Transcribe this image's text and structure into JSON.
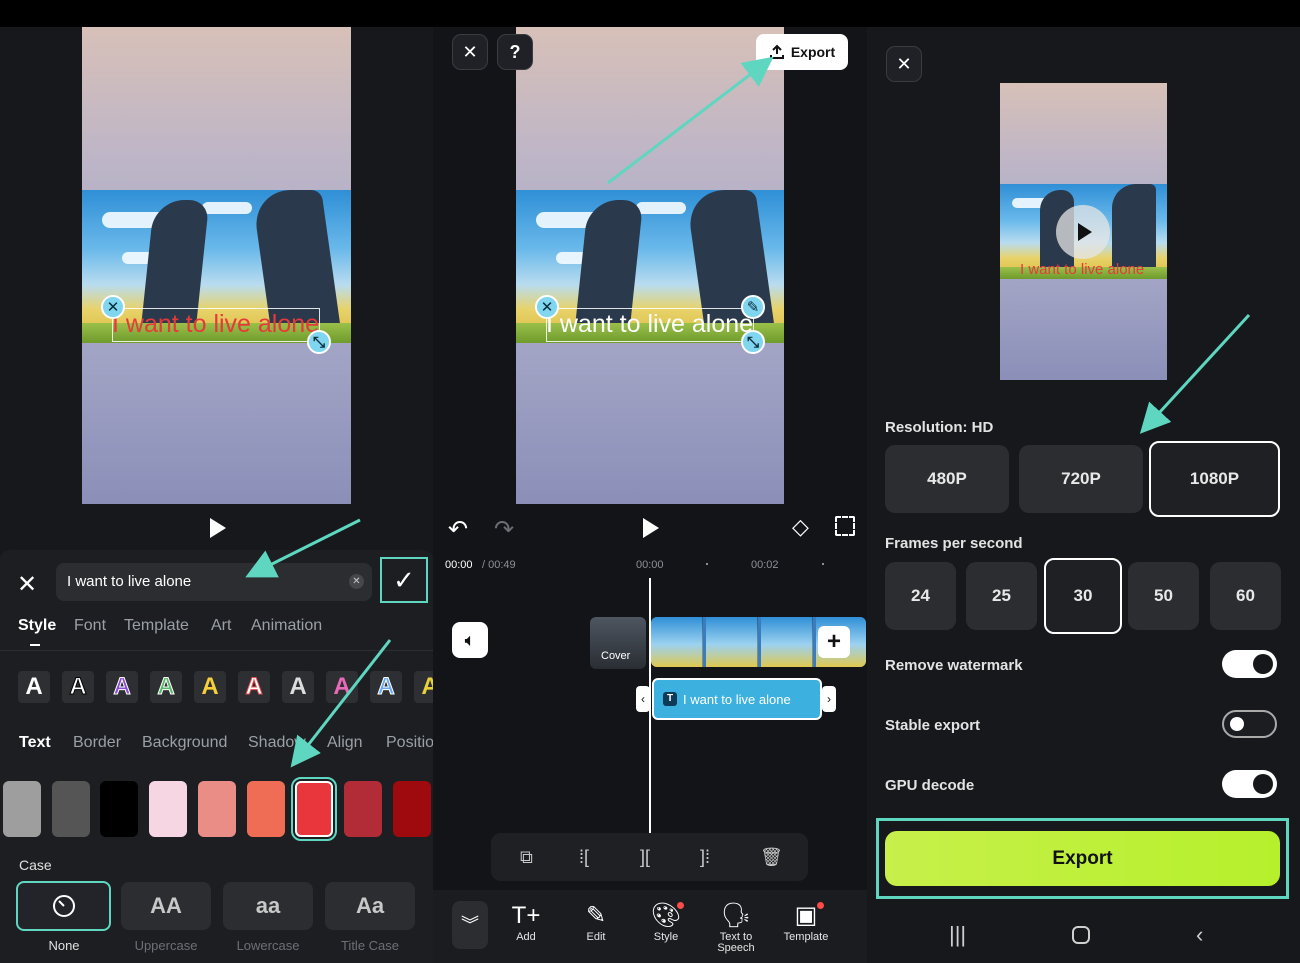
{
  "panel1": {
    "subtitle_text": "I want to live alone",
    "input_value": "I want to live alone",
    "tabs": [
      "Style",
      "Font",
      "Template",
      "Art",
      "Animation"
    ],
    "active_tab": "Style",
    "style_presets": [
      "A",
      "A",
      "A",
      "A",
      "A",
      "A",
      "A",
      "A",
      "A",
      "A"
    ],
    "subtabs": [
      "Text",
      "Border",
      "Background",
      "Shadow",
      "Align",
      "Positio"
    ],
    "active_subtab": "Text",
    "colors": [
      "#9e9e9e",
      "#555555",
      "#000000",
      "#f6d6e3",
      "#ea8d86",
      "#ef6d55",
      "#e9363c",
      "#b22c38",
      "#9e0a0d"
    ],
    "selected_color": "#e9363c",
    "case_label": "Case",
    "case_options": [
      {
        "icon": "none-icon",
        "glyph": "⃠",
        "label": "None"
      },
      {
        "glyph": "AA",
        "label": "Uppercase"
      },
      {
        "glyph": "aa",
        "label": "Lowercase"
      },
      {
        "glyph": "Aa",
        "label": "Title Case"
      }
    ],
    "selected_case": "None"
  },
  "panel2": {
    "export_label": "Export",
    "subtitle_text": "I want to live alone",
    "time_current": "00:00",
    "time_total": "/ 00:49",
    "ticks": [
      "00:00",
      "00:02"
    ],
    "cover_label": "Cover",
    "text_clip_label": "I want to live alone",
    "bottom_items": [
      {
        "label": "Add",
        "icon": "add-text-icon"
      },
      {
        "label": "Edit",
        "icon": "edit-icon"
      },
      {
        "label": "Style",
        "icon": "style-icon"
      },
      {
        "label": "Text to Speech",
        "icon": "text-to-speech-icon"
      },
      {
        "label": "Template",
        "icon": "template-icon"
      }
    ]
  },
  "panel3": {
    "subtitle_text": "I want to live alone",
    "resolution_label": "Resolution: HD",
    "resolutions": [
      "480P",
      "720P",
      "1080P"
    ],
    "selected_resolution": "1080P",
    "fps_label": "Frames per second",
    "fps_options": [
      "24",
      "25",
      "30",
      "50",
      "60"
    ],
    "selected_fps": "30",
    "toggles": [
      {
        "label": "Remove watermark",
        "on": true
      },
      {
        "label": "Stable export",
        "on": false
      },
      {
        "label": "GPU decode",
        "on": true
      }
    ],
    "export_button": "Export"
  },
  "colors": {
    "accent_teal": "#5fd6c0",
    "export_green": "#c7f04a",
    "subtitle_red": "#e8383a"
  }
}
